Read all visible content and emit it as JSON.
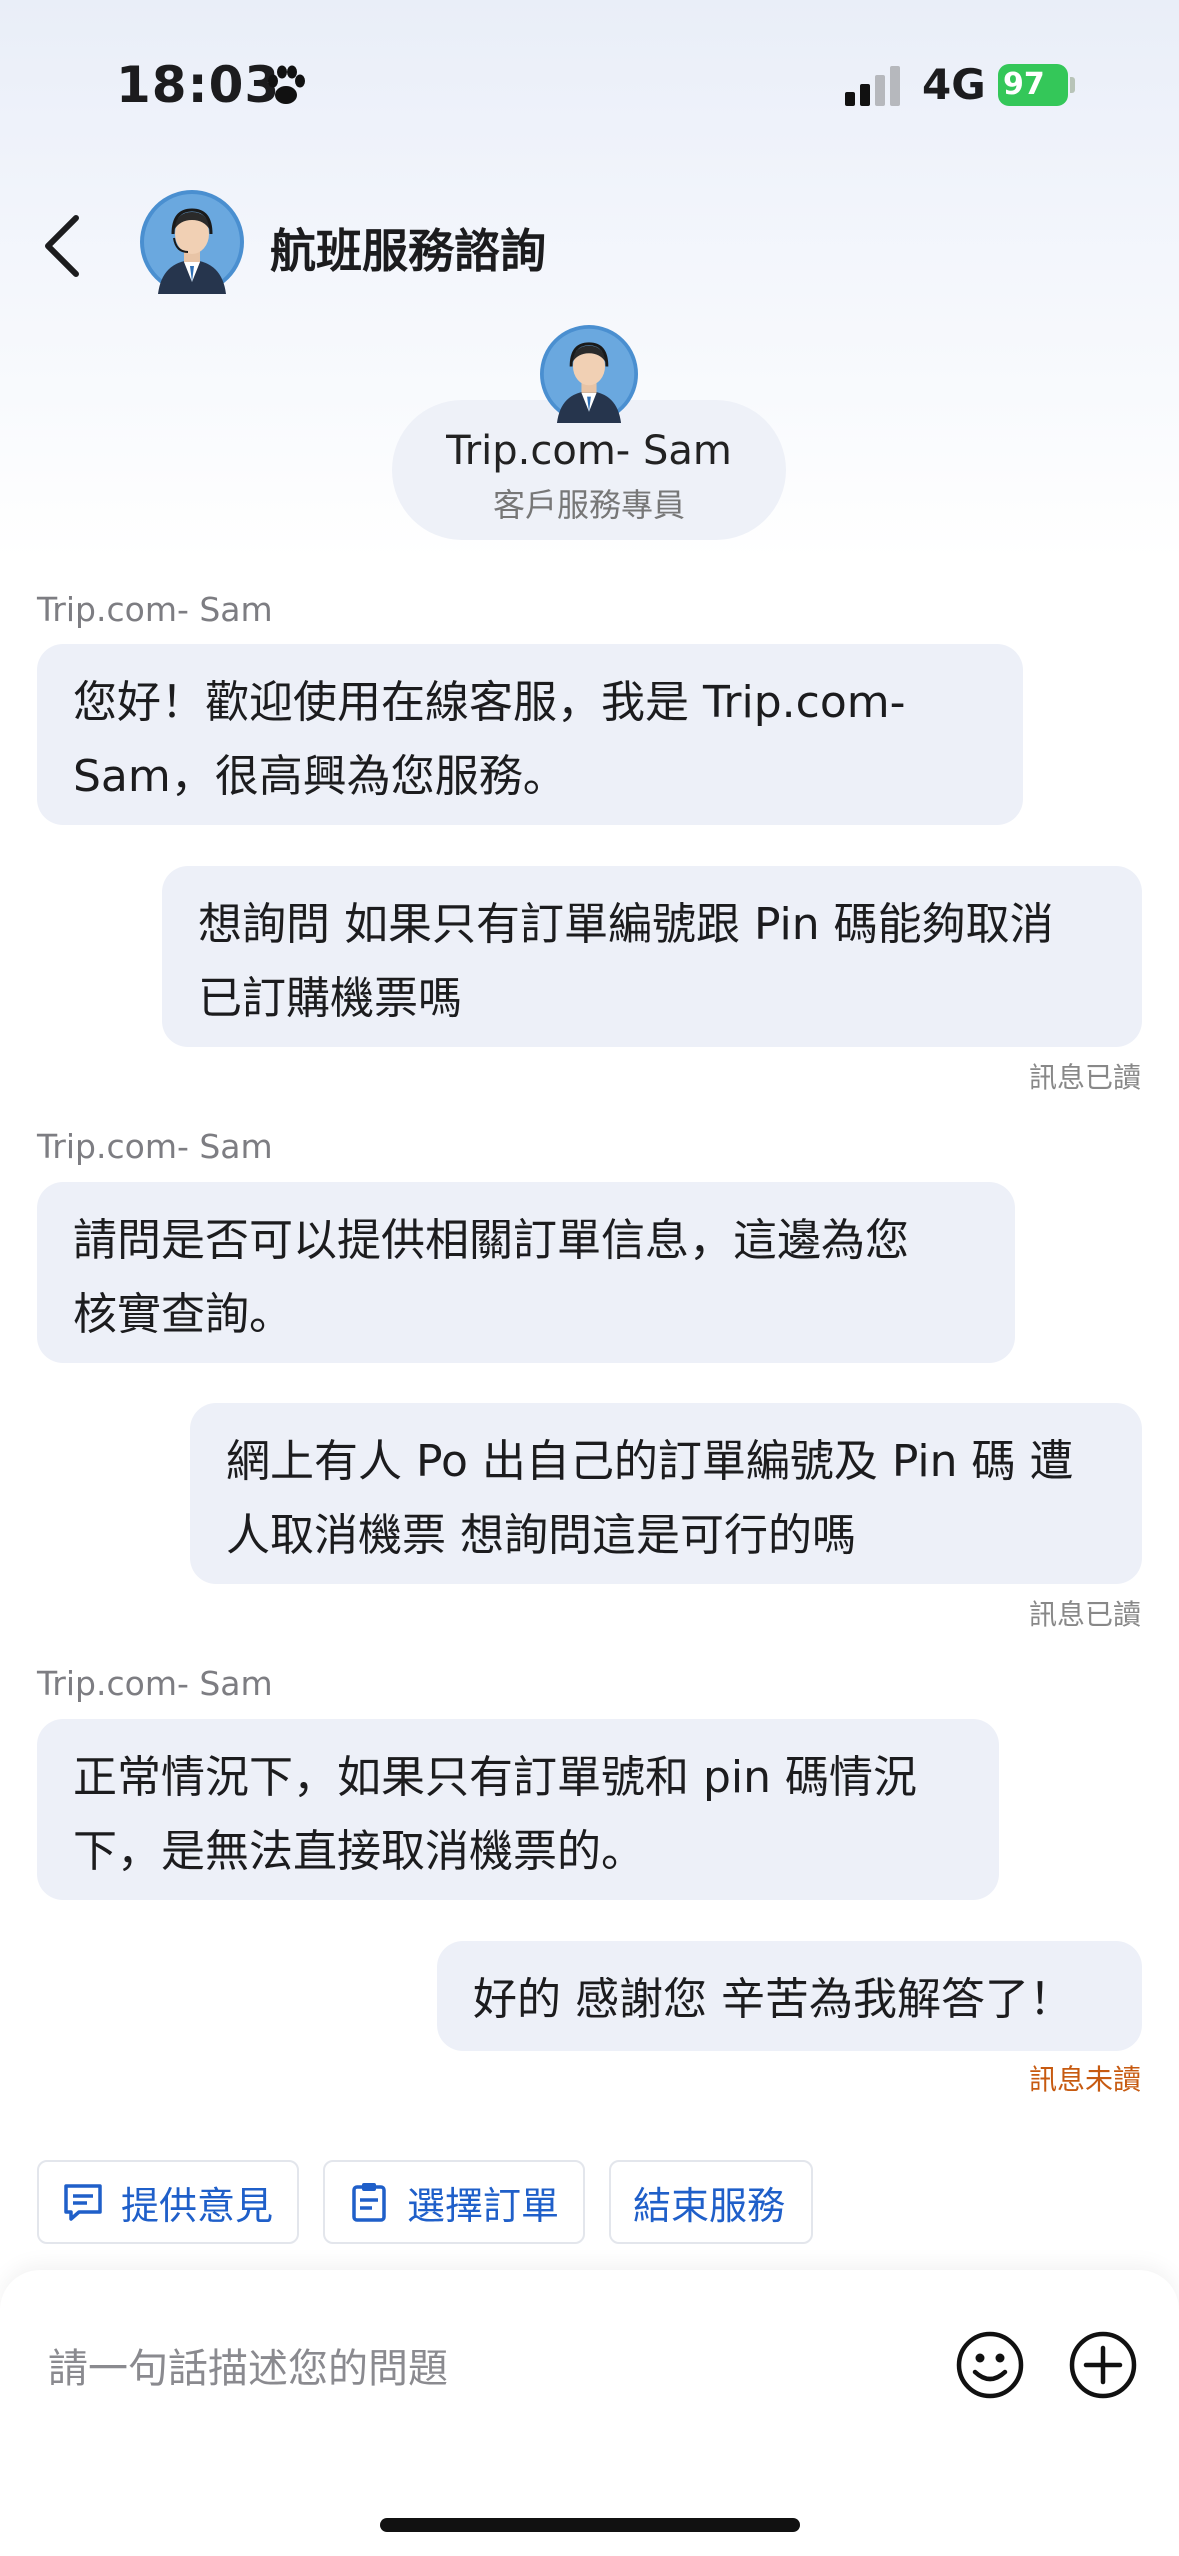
{
  "status_bar": {
    "time": "18:03",
    "network": "4G",
    "battery": "97"
  },
  "header": {
    "title": "航班服務諮詢"
  },
  "agent": {
    "name": "Trip.com-  Sam",
    "role": "客戶服務專員"
  },
  "messages": [
    {
      "sender": "Trip.com-  Sam",
      "text": "您好！歡迎使用在線客服，我是 Trip.com-\nSam，很高興為您服務。"
    },
    {
      "text": "想詢問 如果只有訂單編號跟 Pin 碼能夠取消\n已訂購機票嗎",
      "status": "訊息已讀"
    },
    {
      "sender": "Trip.com-  Sam",
      "text": "請問是否可以提供相關訂單信息，這邊為您\n核實查詢。"
    },
    {
      "text": "網上有人 Po 出自己的訂單編號及 Pin 碼 遭\n人取消機票 想詢問這是可行的嗎",
      "status": "訊息已讀"
    },
    {
      "sender": "Trip.com-  Sam",
      "text": "正常情況下，如果只有訂單號和 pin 碼情況\n下，是無法直接取消機票的。"
    },
    {
      "text": "好的 感謝您 辛苦為我解答了！",
      "status": "訊息未讀"
    }
  ],
  "quick_actions": [
    "提供意見",
    "選擇訂單",
    "結束服務"
  ],
  "input": {
    "placeholder": "請一句話描述您的問題"
  }
}
